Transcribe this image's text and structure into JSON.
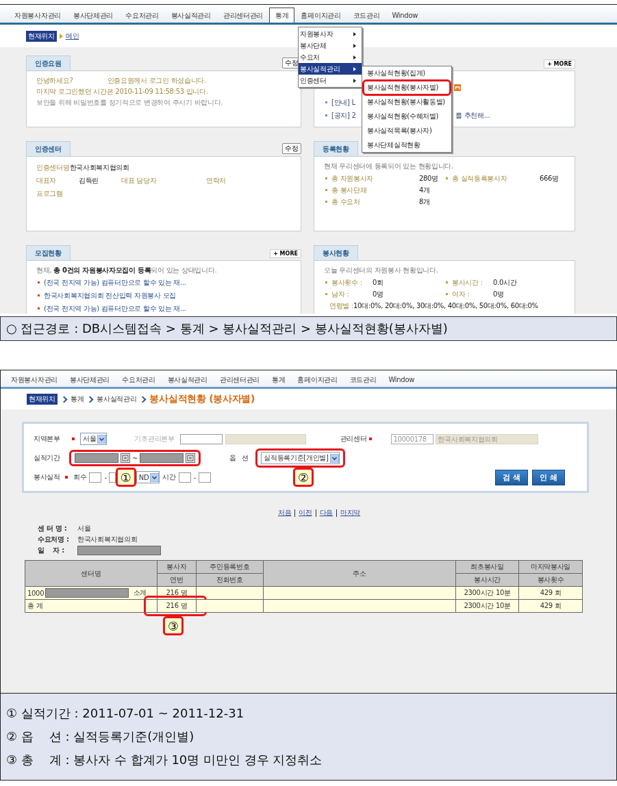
{
  "screen1": {
    "menu": [
      {
        "label": "자원봉사자관리",
        "selected": false
      },
      {
        "label": "봉사단체관리",
        "selected": false
      },
      {
        "label": "수요처관리",
        "selected": false
      },
      {
        "label": "봉사실적관리",
        "selected": false
      },
      {
        "label": "관리센터관리",
        "selected": false
      },
      {
        "label": "통계",
        "selected": true
      },
      {
        "label": "홈페이지관리",
        "selected": false
      },
      {
        "label": "코드관리",
        "selected": false
      },
      {
        "label": "Window",
        "selected": false
      }
    ],
    "breadcrumb": {
      "badge": "현재위치",
      "current": "메인"
    },
    "dropdown": [
      {
        "label": "자원봉사자",
        "selected": false
      },
      {
        "label": "봉사단체",
        "selected": false
      },
      {
        "label": "수요처",
        "selected": false
      },
      {
        "label": "봉사실적관리",
        "selected": true
      },
      {
        "label": "인증센터",
        "selected": false
      }
    ],
    "submenu": [
      {
        "label": "봉사실적현황(집계)",
        "highlighted": false
      },
      {
        "label": "봉사실적현황(봉사자별)",
        "highlighted": true
      },
      {
        "label": "봉사실적현황(봉사활동별)",
        "highlighted": false
      },
      {
        "label": "봉사실적현황(수혜처별)",
        "highlighted": false
      },
      {
        "label": "봉사실적목록(봉사자)",
        "highlighted": false
      },
      {
        "label": "봉사단체실적현황",
        "highlighted": false
      }
    ],
    "panels": [
      {
        "kind": "message",
        "title": "인증요원",
        "button": "수정",
        "lines": [
          {
            "texts": [
              "안녕하세요?",
              "인증요원께서 로그인 하셨습니다."
            ],
            "muted": false
          },
          {
            "texts": [
              "마지막 로그인했던 시간은 2010-11-09 11:58:53 입니다."
            ],
            "muted": false
          },
          {
            "texts": [
              "보안을 위해 비밀번호를 정기적으로 변경하여 주시기 바랍니다."
            ],
            "muted": true
          }
        ]
      },
      {
        "kind": "notice",
        "more": "+ MORE",
        "items": [
          {
            "head": "[안내] L"
          },
          {
            "head": "[공지] 2",
            "tail": "를 추천해..."
          }
        ]
      },
      {
        "kind": "fields",
        "title": "인증센터",
        "button": "수정",
        "rows": [
          [
            {
              "label": "인증센터명",
              "value": "한국사회복지협의회"
            }
          ],
          [
            {
              "label": "대표자",
              "value": "김득린"
            },
            {
              "label": "대표 담당자"
            },
            {
              "label": "연락처"
            }
          ],
          [
            {
              "label": "프로그램"
            }
          ]
        ]
      },
      {
        "kind": "stats",
        "title": "등록현황",
        "intro": "현재 우리센터에 등록되어 있는 현황입니다.",
        "rows": [
          [
            {
              "label": "총 자원봉사자",
              "value": "280명"
            },
            {
              "label": "총 실적등록봉사자",
              "value": "666명"
            }
          ],
          [
            {
              "label": "총 봉사단체",
              "value": "4개"
            }
          ],
          [
            {
              "label": "총 수요처",
              "value": "8개"
            }
          ]
        ]
      },
      {
        "kind": "recruit",
        "title": "모집현황",
        "more": "+ MORE",
        "intro": "현재, **총 0건의 자원봉사자모집이 등록**되어 있는 상태입니다.",
        "links": [
          "(전국 전지역 가능) 컴퓨터만으로 할수 있는 재...",
          "한국사회복지협의회 전산입력 자원봉사 모집",
          "(전국 전지역 가능) 컴퓨터만으로 할수 있는 재..."
        ]
      },
      {
        "kind": "summary",
        "title": "봉사현황",
        "intro": "오늘 우리센터의 자원봉사 현황입니다.",
        "rows": [
          [
            {
              "label": "봉사횟수 :",
              "value": "0회"
            },
            {
              "label": "봉사시간 :",
              "value": "0.0시간"
            }
          ],
          [
            {
              "label": "남자 :",
              "value": "0명"
            },
            {
              "label": "여자 :",
              "value": "0명"
            }
          ],
          [
            {
              "label": "연령별 :",
              "value": "10대:0%, 20대:0%, 30대:0%, 40대:0%, 50대:0%, 60대:0%"
            }
          ]
        ]
      }
    ]
  },
  "caption": "○ 접근경로 : DB시스템접속 > 통계 > 봉사실적관리 > 봉사실적현황(봉사자별)",
  "screen2": {
    "menu": [
      "자원봉사자관리",
      "봉사단체관리",
      "수요처관리",
      "봉사실적관리",
      "관리센터관리",
      "통계",
      "홈페이지관리",
      "코드관리",
      "Window"
    ],
    "breadcrumb": {
      "badge": "현재위치",
      "path": [
        "통계",
        "봉사실적관리"
      ],
      "current": "봉사실적현황 (봉사자별)"
    },
    "form": {
      "region": {
        "label": "지역본부",
        "required": true,
        "value": "서울"
      },
      "base": {
        "label": "기초관리본부"
      },
      "center": {
        "label": "관리센터",
        "required": true,
        "code": "10000178",
        "name": "한국사회복지협의회"
      },
      "period": {
        "label": "실적기간",
        "separator": "~",
        "highlighted": true
      },
      "option": {
        "label": "옵   션",
        "value": "실적등록기준[개인별]",
        "highlighted": true
      },
      "record": {
        "label": "봉사실적",
        "required": true,
        "count_label": "회수",
        "count_separator": "-",
        "operator": "ND",
        "time_label": "시간",
        "time_separator": "-"
      },
      "callouts": [
        "①",
        "②"
      ],
      "buttons": [
        "검 색",
        "인 쇄"
      ]
    },
    "paging": [
      "처음",
      "이전",
      "다음",
      "마지막"
    ],
    "info": [
      {
        "kind": "text",
        "label": "센 터 명 :",
        "value": "서울"
      },
      {
        "kind": "text",
        "label": "수요처명 :",
        "value": "한국사회복지협의회"
      },
      {
        "kind": "redacted",
        "label": "일    자 :"
      }
    ],
    "table": {
      "header_top": [
        "센터명",
        "봉사자",
        "주민등록번호",
        "주소",
        "최초봉사일",
        "마지막봉사일"
      ],
      "header_bottom": [
        "연번",
        "전화번호",
        "봉사시간",
        "봉사횟수"
      ],
      "rows": [
        {
          "kind": "subtotal",
          "center": "1000",
          "subtotal": "소계",
          "volunteers": "216 명",
          "time": "2300시간 10분",
          "count": "429 회",
          "highlighted": false
        },
        {
          "kind": "total",
          "center": "총 계",
          "volunteers": "216 명",
          "time": "2300시간 10분",
          "count": "429 회",
          "highlighted": true,
          "callout": "③"
        }
      ]
    }
  },
  "notes": [
    "① 실적기간 : 2011-07-01 ~ 2011-12-31",
    "② 옵    션 : 실적등록기준(개인별)",
    "③ 총    계 : 봉사자 수 합계가 10명 미만인 경우 지정취소"
  ]
}
